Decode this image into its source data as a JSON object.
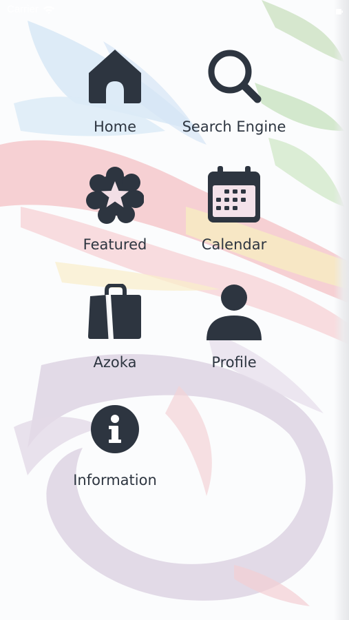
{
  "status_bar": {
    "carrier": "Carrier",
    "wifi_icon": "wifi-icon",
    "battery_icon": "battery-icon"
  },
  "colors": {
    "icon": "#2d3540",
    "label": "#2d3540",
    "bg_blue": "#cfe3f4",
    "bg_red": "#f3b9bd",
    "bg_green": "#cfe5c8",
    "bg_yellow": "#f9ecc0",
    "bg_purple": "#dcd3e2"
  },
  "menu": {
    "items": [
      {
        "label": "Home",
        "icon": "home-icon"
      },
      {
        "label": "Search Engine",
        "icon": "search-icon"
      },
      {
        "label": "Featured",
        "icon": "star-badge-icon"
      },
      {
        "label": "Calendar",
        "icon": "calendar-icon"
      },
      {
        "label": "Azoka",
        "icon": "shopping-bag-icon"
      },
      {
        "label": "Profile",
        "icon": "user-icon"
      },
      {
        "label": "Information",
        "icon": "info-icon"
      }
    ]
  }
}
